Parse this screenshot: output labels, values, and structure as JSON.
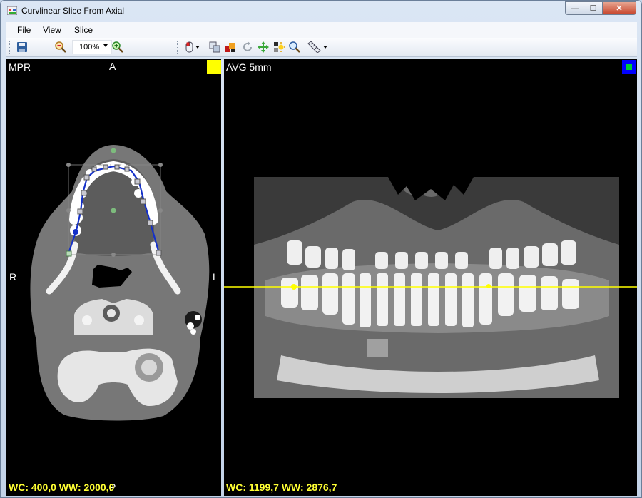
{
  "window": {
    "title": "Curvlinear Slice From Axial",
    "controls": {
      "minimize": "—",
      "maximize": "☐",
      "close": "✕"
    }
  },
  "menu": {
    "items": [
      {
        "label": "File"
      },
      {
        "label": "View"
      },
      {
        "label": "Slice"
      }
    ]
  },
  "toolbar": {
    "zoom_value": "100%",
    "icons": [
      "save-icon",
      "zoom-out-icon",
      "zoom-in-icon",
      "mouse-mode-icon",
      "copy-icon",
      "marker-icon",
      "rotate-icon",
      "move-icon",
      "brightness-icon",
      "search-icon",
      "measure-icon"
    ]
  },
  "left_view": {
    "mode_label": "MPR",
    "orientation_top": "A",
    "orientation_left": "R",
    "orientation_right": "L",
    "orientation_bottom": "P",
    "wc_ww": "WC: 400,0 WW: 2000,0",
    "swatch_color": "#ffff00"
  },
  "right_view": {
    "mode_label": "AVG 5mm",
    "wc_ww": "WC: 1199,7 WW: 2876,7",
    "swatch_color": "#0000ff",
    "cursor_line_color": "#ffff00"
  }
}
